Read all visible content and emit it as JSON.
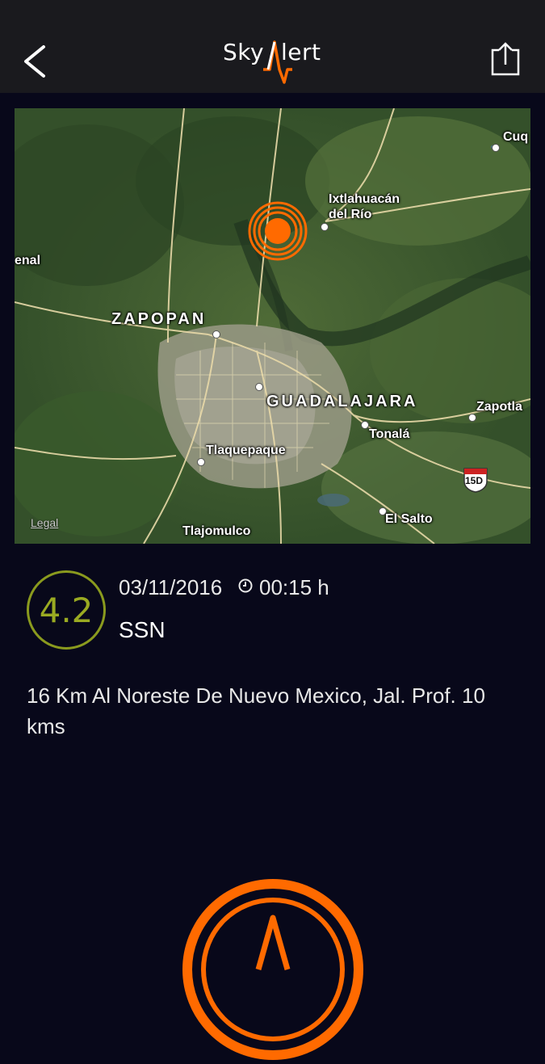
{
  "header": {
    "back_icon": "chevron-left-icon",
    "logo_text_left": "Sky",
    "logo_text_right": "lert",
    "share_icon": "share-icon",
    "accent_color": "#ff6a00"
  },
  "map": {
    "labels": {
      "cuq": "Cuq",
      "ixtlahuacan_line1": "Ixtlahuacán",
      "ixtlahuacan_line2": "del Río",
      "enal": "enal",
      "zapopan": "ZAPOPAN",
      "guadalajara": "GUADALAJARA",
      "zapotla": "Zapotla",
      "tonala": "Tonalá",
      "tlaquepaque": "Tlaquepaque",
      "highway": "15D",
      "el_salto": "El Salto",
      "tlajomulco": "Tlajomulco"
    },
    "legal": "Legal",
    "epicenter_icon": "epicenter-marker-icon"
  },
  "quake": {
    "magnitude": "4.2",
    "date": "03/11/2016",
    "time": "00:15 h",
    "clock_icon": "clock-icon",
    "source": "SSN",
    "description": "16 Km Al Noreste De  Nuevo Mexico, Jal. Prof. 10 kms",
    "magnitude_color": "#8a9a1e"
  },
  "footer": {
    "alert_icon": "skyalert-button-icon"
  }
}
